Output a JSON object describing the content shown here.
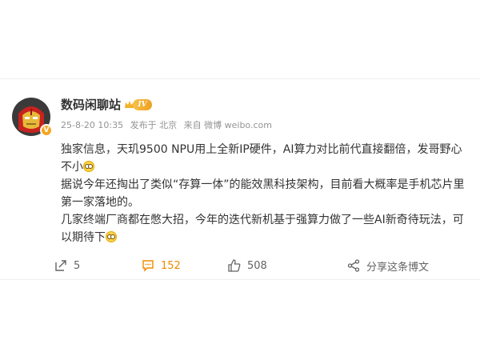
{
  "post": {
    "author": "数码闲聊站",
    "level": "IV",
    "verified_badge": "V",
    "timestamp": "25-8-20 10:35",
    "location": "发布于 北京",
    "source": "来自 微博 weibo.com",
    "paragraphs": [
      {
        "text": "独家信息，天玑9500 NPU用上全新IP硬件，AI算力对比前代直接翻倍，发哥野心不小",
        "emoji": true
      },
      {
        "text": "据说今年还掏出了类似“存算一体”的能效黑科技架构，目前看大概率是手机芯片里第一家落地的。",
        "emoji": false
      },
      {
        "text": "几家终端厂商都在憋大招，今年的迭代新机基于强算力做了一些AI新奇待玩法，可以期待下",
        "emoji": true
      }
    ]
  },
  "actions": {
    "repost_count": "5",
    "comment_count": "152",
    "like_count": "508",
    "share_label": "分享这条博文"
  },
  "colors": {
    "accent_orange": "#f08a00",
    "meta_gray": "#939393",
    "text": "#333333"
  },
  "icons": [
    "avatar-ironman",
    "crown-icon",
    "repost-icon",
    "comment-icon",
    "like-icon",
    "share-icon",
    "emoji-icon"
  ]
}
